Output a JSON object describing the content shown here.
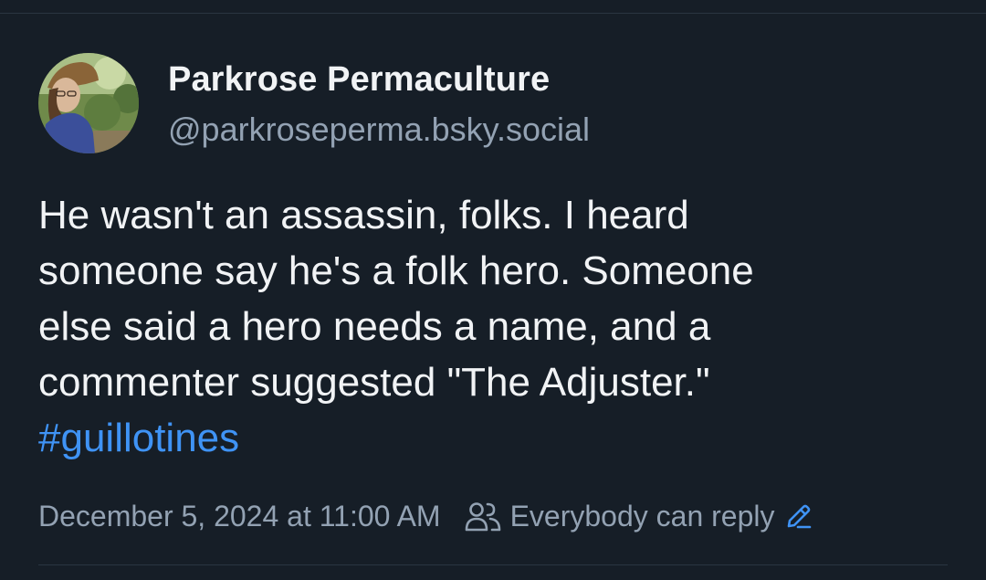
{
  "post": {
    "author": {
      "display_name": "Parkrose Permaculture",
      "handle": "@parkroseperma.bsky.social",
      "avatar_icon": "avatar-photo"
    },
    "text_lines": [
      "He wasn't an assassin, folks. I heard",
      "someone say he's a folk hero. Someone",
      "else said a hero needs a name, and a",
      "commenter suggested \"The Adjuster.\""
    ],
    "hashtag": "#guillotines",
    "timestamp": "December 5, 2024 at 11:00 AM",
    "reply_setting": {
      "icon": "people-icon",
      "label": "Everybody can reply",
      "edit_icon": "pencil-icon"
    }
  },
  "colors": {
    "background": "#161e27",
    "text_primary": "#f1f3f5",
    "text_secondary": "#93a2b3",
    "link": "#3f93f5",
    "divider": "#2a3541"
  }
}
